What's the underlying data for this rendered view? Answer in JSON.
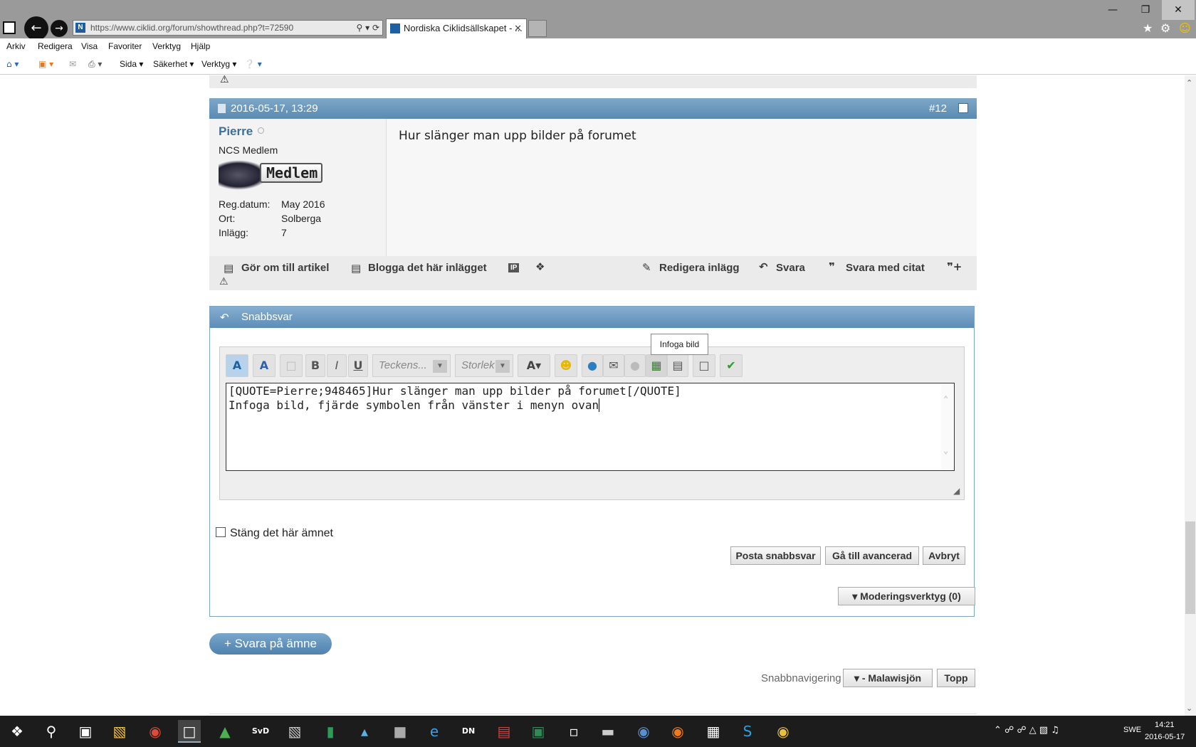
{
  "browser": {
    "url": "https://www.ciklid.org/forum/showthread.php?t=72590",
    "tab_title": "Nordiska Ciklidsällskapet - ...",
    "menu": [
      "Arkiv",
      "Redigera",
      "Visa",
      "Favoriter",
      "Verktyg",
      "Hjälp"
    ],
    "cmd": {
      "sida": "Sida",
      "sakerhet": "Säkerhet",
      "verktyg": "Verktyg"
    }
  },
  "post": {
    "date": "2016-05-17, 13:29",
    "number": "#12",
    "username": "Pierre",
    "usertitle": "NCS Medlem",
    "rank_badge": "Medlem",
    "info": [
      {
        "label": "Reg.datum:",
        "value": "May 2016"
      },
      {
        "label": "Ort:",
        "value": "Solberga"
      },
      {
        "label": "Inlägg:",
        "value": "7"
      }
    ],
    "message": "Hur slänger man upp bilder på forumet",
    "actions": {
      "article": "Gör om till artikel",
      "blog": "Blogga det här inlägget",
      "ip": "IP",
      "edit": "Redigera inlägg",
      "reply": "Svara",
      "quote": "Svara med citat"
    }
  },
  "quickreply": {
    "title": "Snabbsvar",
    "tooltip": "Infoga bild",
    "font_placeholder": "Teckens...",
    "size_placeholder": "Storlek",
    "text_line1": "[QUOTE=Pierre;948465]Hur slänger man upp bilder på forumet[/QUOTE]",
    "text_line2": "Infoga bild, fjärde symbolen från vänster i menyn ovan",
    "close_topic": "Stäng det här ämnet",
    "post_button": "Posta snabbsvar",
    "advanced_button": "Gå till avancerad",
    "cancel_button": "Avbryt"
  },
  "moderation": "Moderingsverktyg (0)",
  "reply_topic": "+ Svara på ämne",
  "quicknav": {
    "label": "Snabbnavigering",
    "forum": "- Malawisjön",
    "top": "Topp"
  },
  "taskbar": {
    "lang": "SWE",
    "time": "14:21",
    "date": "2016-05-17"
  },
  "colors": {
    "accent": "#5a8ab2",
    "username": "#3e6f99",
    "taskbar": "#1c1c1c"
  }
}
